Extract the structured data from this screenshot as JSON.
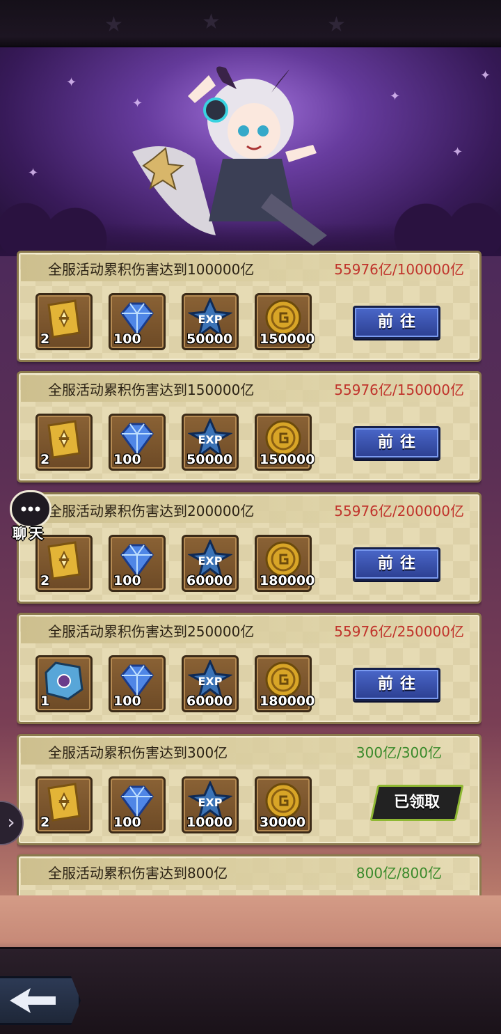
{
  "tasks": [
    {
      "title": "全服活动累积伤害达到100000亿",
      "progress": "55976亿/100000亿",
      "status": "incomplete",
      "action_label": "前往",
      "rewards": [
        {
          "icon": "golden-item-icon",
          "qty": "2"
        },
        {
          "icon": "diamond-icon",
          "qty": "100"
        },
        {
          "icon": "exp-icon",
          "qty": "50000"
        },
        {
          "icon": "gold-coin-icon",
          "qty": "150000"
        }
      ]
    },
    {
      "title": "全服活动累积伤害达到150000亿",
      "progress": "55976亿/150000亿",
      "status": "incomplete",
      "action_label": "前往",
      "rewards": [
        {
          "icon": "golden-item-icon",
          "qty": "2"
        },
        {
          "icon": "diamond-icon",
          "qty": "100"
        },
        {
          "icon": "exp-icon",
          "qty": "50000"
        },
        {
          "icon": "gold-coin-icon",
          "qty": "150000"
        }
      ]
    },
    {
      "title": "全服活动累积伤害达到200000亿",
      "progress": "55976亿/200000亿",
      "status": "incomplete",
      "action_label": "前往",
      "rewards": [
        {
          "icon": "golden-item-icon",
          "qty": "2"
        },
        {
          "icon": "diamond-icon",
          "qty": "100"
        },
        {
          "icon": "exp-icon",
          "qty": "60000"
        },
        {
          "icon": "gold-coin-icon",
          "qty": "180000"
        }
      ]
    },
    {
      "title": "全服活动累积伤害达到250000亿",
      "progress": "55976亿/250000亿",
      "status": "incomplete",
      "action_label": "前往",
      "rewards": [
        {
          "icon": "crystal-icon",
          "qty": "1"
        },
        {
          "icon": "diamond-icon",
          "qty": "100"
        },
        {
          "icon": "exp-icon",
          "qty": "60000"
        },
        {
          "icon": "gold-coin-icon",
          "qty": "180000"
        }
      ]
    },
    {
      "title": "全服活动累积伤害达到300亿",
      "progress": "300亿/300亿",
      "status": "claimed",
      "action_label": "已领取",
      "rewards": [
        {
          "icon": "golden-item-icon",
          "qty": "2"
        },
        {
          "icon": "diamond-icon",
          "qty": "100"
        },
        {
          "icon": "exp-icon",
          "qty": "10000"
        },
        {
          "icon": "gold-coin-icon",
          "qty": "30000"
        }
      ]
    },
    {
      "title": "全服活动累积伤害达到800亿",
      "progress": "800亿/800亿",
      "status": "claimed",
      "action_label": "",
      "rewards": []
    }
  ],
  "chat": {
    "label": "聊天"
  },
  "colors": {
    "incomplete": "#c0332b",
    "complete": "#3a8a2b",
    "button": "#3a55b0"
  }
}
